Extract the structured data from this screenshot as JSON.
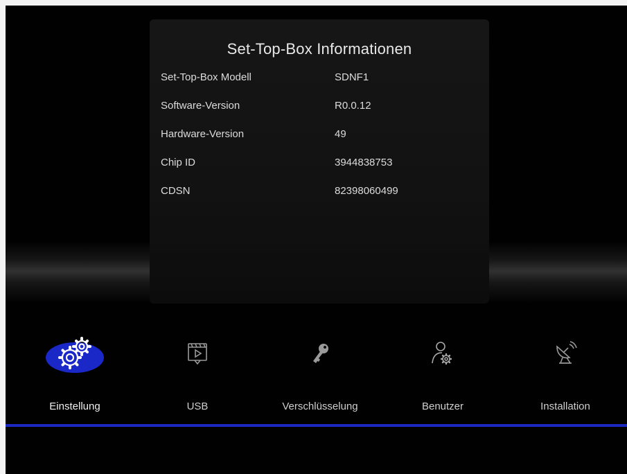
{
  "panel": {
    "title": "Set-Top-Box Informationen",
    "rows": [
      {
        "label": "Set-Top-Box Modell",
        "value": "SDNF1"
      },
      {
        "label": "Software-Version",
        "value": "R0.0.12"
      },
      {
        "label": "Hardware-Version",
        "value": "49"
      },
      {
        "label": "Chip ID",
        "value": "3944838753"
      },
      {
        "label": "CDSN",
        "value": "82398060499"
      }
    ]
  },
  "menu": {
    "items": [
      {
        "label": "Einstellung",
        "icon": "settings-gears-icon",
        "selected": true
      },
      {
        "label": "USB",
        "icon": "usb-media-icon",
        "selected": false
      },
      {
        "label": "Verschlüsselung",
        "icon": "key-icon",
        "selected": false
      },
      {
        "label": "Benutzer",
        "icon": "user-settings-icon",
        "selected": false
      },
      {
        "label": "Installation",
        "icon": "satellite-dish-icon",
        "selected": false
      }
    ]
  },
  "colors": {
    "background": "#010101",
    "panel": "#151515",
    "accent_blue": "#1c28c4",
    "text": "#e6e6e6"
  }
}
